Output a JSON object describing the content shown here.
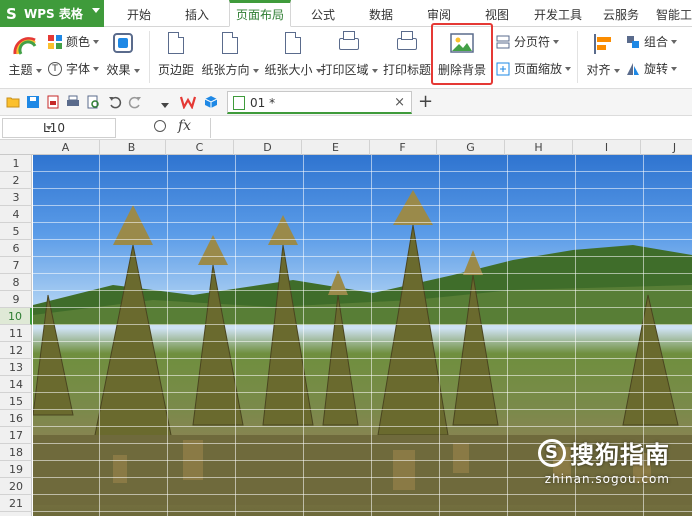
{
  "app": {
    "logo_text": "WPS 表格"
  },
  "menu_tabs": [
    {
      "label": "开始"
    },
    {
      "label": "插入"
    },
    {
      "label": "页面布局",
      "active": true
    },
    {
      "label": "公式"
    },
    {
      "label": "数据"
    },
    {
      "label": "审阅"
    },
    {
      "label": "视图"
    },
    {
      "label": "开发工具"
    },
    {
      "label": "云服务"
    },
    {
      "label": "智能工"
    }
  ],
  "ribbon": {
    "theme": "主题",
    "colors": "颜色",
    "fonts": "字体",
    "effects": "效果",
    "margins": "页边距",
    "orientation": "纸张方向",
    "size": "纸张大小",
    "print_area": "打印区域",
    "print_titles": "打印标题",
    "delete_background": "删除背景",
    "page_break": "分页符",
    "page_zoom": "页面缩放",
    "align": "对齐",
    "group": "组合",
    "rotate": "旋转"
  },
  "doc_tab": {
    "name": "01 *",
    "close": "×"
  },
  "formula_bar": {
    "cell_ref": "L10",
    "fx": "fx",
    "value": ""
  },
  "columns": [
    "A",
    "B",
    "C",
    "D",
    "E",
    "F",
    "G",
    "H",
    "I",
    "J"
  ],
  "rows": [
    "1",
    "2",
    "3",
    "4",
    "5",
    "6",
    "7",
    "8",
    "9",
    "10",
    "11",
    "12",
    "13",
    "14",
    "15",
    "16",
    "17",
    "18",
    "19",
    "20",
    "21"
  ],
  "selected_row": "10",
  "watermark": {
    "brand": "搜狗指南",
    "domain": "zhinan.sogou.com"
  },
  "colors": {
    "accent": "#3f9b3b",
    "highlight": "#e53935"
  }
}
